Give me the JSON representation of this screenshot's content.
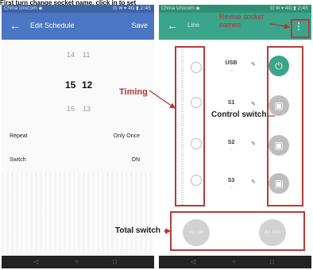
{
  "caption": "First turn change socket name, click in to set",
  "left_phone": {
    "status_left": "China Unicom ◆",
    "status_right": "⊡ ✉ ▾ 4G ▮ 2:45",
    "appbar": {
      "back_icon": "arrow-left-icon",
      "title": "Edit Schedule",
      "save": "Save"
    },
    "picker": {
      "top": {
        "hour": "14",
        "minute": "11"
      },
      "selected": {
        "hour": "15",
        "minute": "12"
      },
      "bottom": {
        "hour": "16",
        "minute": "13"
      }
    },
    "settings": [
      {
        "label": "Repeat",
        "value": "Only Once"
      },
      {
        "label": "Switch",
        "value": "ON"
      }
    ],
    "nav": [
      "◁",
      "○",
      "□"
    ]
  },
  "right_phone": {
    "status_left": "China Unicom ◆",
    "status_right": "⊡ ✉ ▾ 4G ▮ 2:45",
    "appbar": {
      "back_icon": "arrow-left-icon",
      "title": "Line",
      "more_icon": "more-vertical-icon",
      "more_glyph": "⋮"
    },
    "sockets": [
      {
        "name": "USB",
        "sub": "--",
        "edit_icon": "pencil-icon",
        "state": "on"
      },
      {
        "name": "S1",
        "sub": "--",
        "edit_icon": "pencil-icon",
        "state": "off"
      },
      {
        "name": "S2",
        "sub": "--",
        "edit_icon": "pencil-icon",
        "state": "off"
      },
      {
        "name": "S3",
        "sub": "--",
        "edit_icon": "pencil-icon",
        "state": "off"
      }
    ],
    "total_switch": {
      "on_label": "ALL ON",
      "off_label": "ALL OFF"
    },
    "nav": [
      "◁",
      "○",
      "□"
    ]
  },
  "annotations": {
    "timing": "Timing",
    "revise_socket_names": "Revise socket\nnames",
    "control_switch": "Control switch",
    "total_switch": "Total switch"
  },
  "colors": {
    "left_appbar": "#4a76c3",
    "right_appbar": "#3aa58a",
    "highlight": "#b83a3a"
  }
}
